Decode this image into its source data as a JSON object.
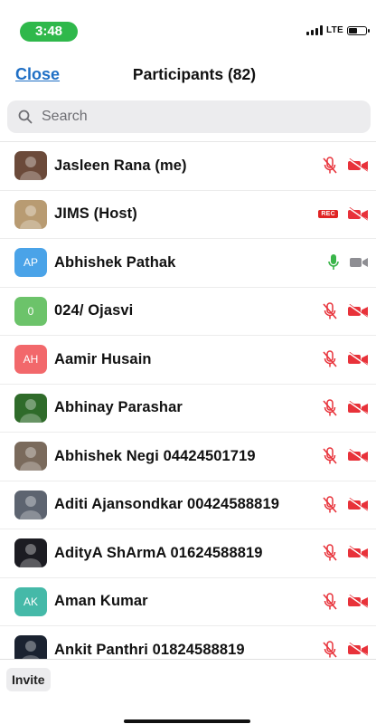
{
  "status_bar": {
    "time": "3:48",
    "network": "LTE"
  },
  "header": {
    "close_label": "Close",
    "title": "Participants (82)"
  },
  "search": {
    "placeholder": "Search"
  },
  "participants": [
    {
      "name": "Jasleen Rana (me)",
      "avatar_initials": "",
      "avatar_type": "photo",
      "avatar_color": "#6b4a3a",
      "mic": "muted",
      "video": "off"
    },
    {
      "name": "JIMS (Host)",
      "avatar_initials": "",
      "avatar_type": "photo",
      "avatar_color": "#b89b72",
      "mic": "recording",
      "video": "off"
    },
    {
      "name": "Abhishek Pathak",
      "avatar_initials": "AP",
      "avatar_type": "initials",
      "avatar_color": "#4aa3e8",
      "mic": "on",
      "video": "off-gray"
    },
    {
      "name": "024/ Ojasvi",
      "avatar_initials": "0",
      "avatar_type": "initials",
      "avatar_color": "#6cc36a",
      "mic": "muted",
      "video": "off"
    },
    {
      "name": "Aamir Husain",
      "avatar_initials": "AH",
      "avatar_type": "initials",
      "avatar_color": "#f2686b",
      "mic": "muted",
      "video": "off"
    },
    {
      "name": "Abhinay Parashar",
      "avatar_initials": "",
      "avatar_type": "photo",
      "avatar_color": "#2f6b2a",
      "mic": "muted",
      "video": "off"
    },
    {
      "name": "Abhishek Negi 04424501719",
      "avatar_initials": "",
      "avatar_type": "photo",
      "avatar_color": "#7a6a5c",
      "mic": "muted",
      "video": "off"
    },
    {
      "name": "Aditi Ajansondkar 00424588819",
      "avatar_initials": "",
      "avatar_type": "photo",
      "avatar_color": "#5d6470",
      "mic": "muted",
      "video": "off"
    },
    {
      "name": "AdityA ShArmA 01624588819",
      "avatar_initials": "",
      "avatar_type": "photo",
      "avatar_color": "#1c1c22",
      "mic": "muted",
      "video": "off"
    },
    {
      "name": "Aman Kumar",
      "avatar_initials": "AK",
      "avatar_type": "initials",
      "avatar_color": "#45b9a8",
      "mic": "muted",
      "video": "off"
    },
    {
      "name": "Ankit Panthri 01824588819",
      "avatar_initials": "",
      "avatar_type": "photo",
      "avatar_color": "#1a2230",
      "mic": "muted",
      "video": "off"
    }
  ],
  "recording_badge": "REC",
  "footer": {
    "invite_label": "Invite"
  },
  "colors": {
    "accent": "#1f6fc5",
    "muted_red": "#e8323a",
    "mic_green": "#3ab54a",
    "status_green": "#2fb84b"
  }
}
